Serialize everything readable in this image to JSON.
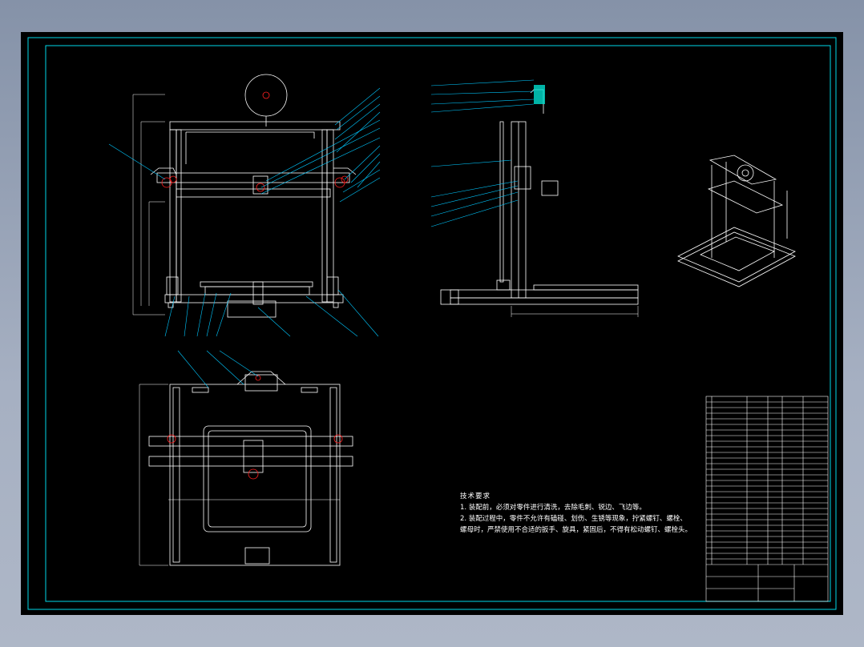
{
  "colors": {
    "background": "#000000",
    "frame": "#00d8e8",
    "part": "#ffffff",
    "accent": "#ff2020",
    "leader": "#00c8ff",
    "fill": "#00e0d0"
  },
  "technical_requirements": {
    "title": "技术要求",
    "item1": "1. 装配前，必须对零件进行清洗，去除毛刺、锐边、飞边等。",
    "item2": "2. 装配过程中，零件不允许有磕碰、划伤、生锈等现象，拧紧螺钉、螺栓、螺母时，严禁使用不合适的扳手、旋具，紧固后，不得有松动螺钉、螺栓头。"
  }
}
